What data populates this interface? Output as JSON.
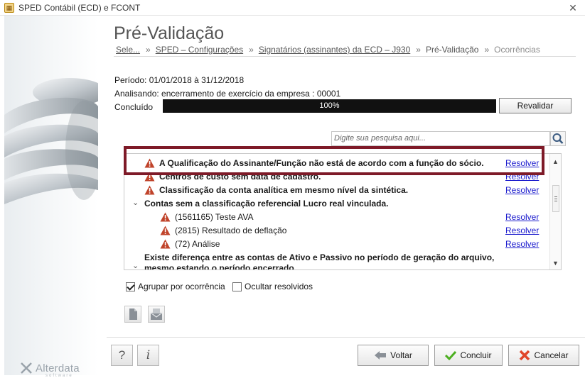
{
  "window": {
    "title": "SPED Contábil (ECD) e FCONT",
    "close_glyph": "✕"
  },
  "page": {
    "title": "Pré-Validação"
  },
  "breadcrumb": {
    "items": [
      {
        "label": "Sele...",
        "link": true
      },
      {
        "label": "SPED – Configurações",
        "link": true
      },
      {
        "label": "Signatários (assinantes) da ECD – J930",
        "link": true
      },
      {
        "label": "Pré-Validação",
        "link": false
      },
      {
        "label": "Ocorrências",
        "link": false
      }
    ],
    "separator": "»"
  },
  "info": {
    "periodo": "Período: 01/01/2018 à 31/12/2018",
    "analisando": "Analisando: encerramento de exercício da empresa : 00001",
    "concluido_label": "Concluído",
    "progress_value": 100,
    "progress_text": "100%"
  },
  "buttons": {
    "revalidar": "Revalidar",
    "voltar": "Voltar",
    "concluir": "Concluir",
    "cancelar": "Cancelar"
  },
  "search": {
    "placeholder": "Digite sua pesquisa aqui..."
  },
  "occurrences": [
    {
      "text": "A Qualificação do Assinante/Função não está de acordo com a função do sócio.",
      "bold": true,
      "icon": "warning-icon",
      "action": "Resolver"
    },
    {
      "text": "Centros de custo sem data de cadastro.",
      "bold": true,
      "icon": "warning-icon",
      "action": "Resolver"
    },
    {
      "text": "Classificação da conta analítica em mesmo nível da sintética.",
      "bold": true,
      "icon": "warning-icon",
      "action": "Resolver"
    },
    {
      "text": "Contas sem a classificação referencial Lucro real vinculada.",
      "bold": true,
      "expander": true
    },
    {
      "text": "(1561165)  Teste AVA",
      "bold": false,
      "icon": "warning-icon",
      "action": "Resolver",
      "child": true
    },
    {
      "text": "(2815)  Resultado de deflação",
      "bold": false,
      "icon": "warning-icon",
      "action": "Resolver",
      "child": true
    },
    {
      "text": "(72)  Análise",
      "bold": false,
      "icon": "warning-icon",
      "action": "Resolver",
      "child": true
    },
    {
      "text": "Existe diferença entre as contas de Ativo e Passivo no período de geração do arquivo,",
      "bold": true,
      "expander": true
    },
    {
      "text": "mesmo estando o período encerrado.",
      "bold": true
    }
  ],
  "options": {
    "agrupar": "Agrupar por ocorrência",
    "agrupar_checked": true,
    "ocultar": "Ocultar resolvidos",
    "ocultar_checked": false
  },
  "help": {
    "question": "?",
    "info": "i"
  },
  "brand": {
    "name": "Alterdata",
    "tagline": "software"
  },
  "colors": {
    "warning": "#c0432a",
    "link": "#1a1acd",
    "highlight": "#7e1a28",
    "progress": "#111111"
  }
}
